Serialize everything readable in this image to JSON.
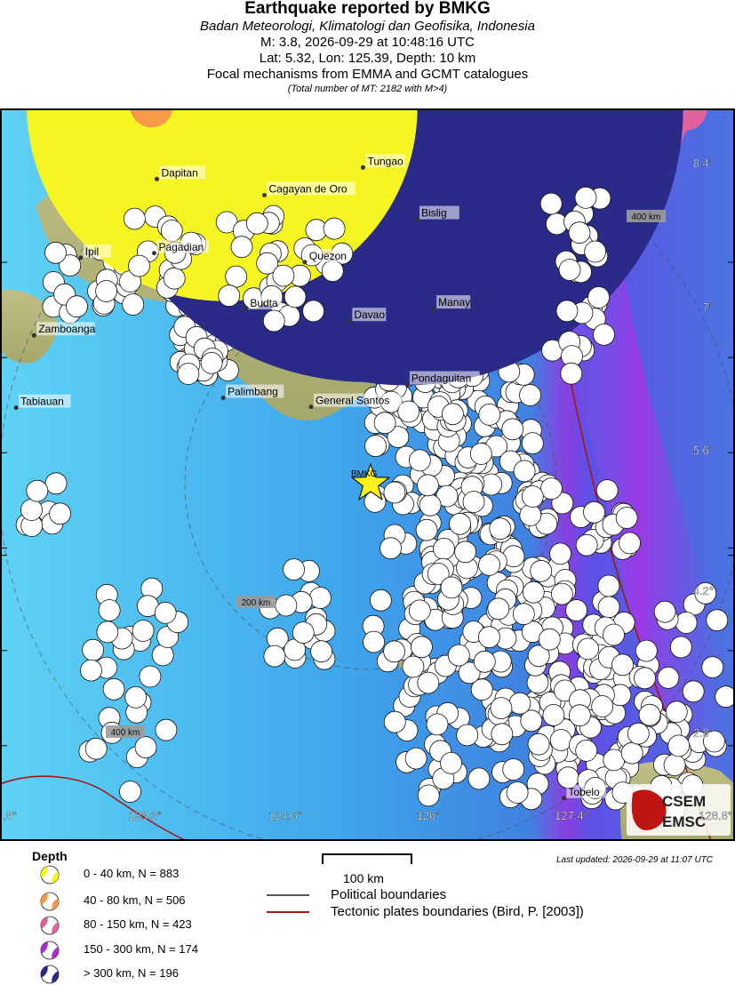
{
  "header": {
    "title": "Earthquake reported by BMKG",
    "agency": "Badan Meteorologi, Klimatologi dan Geofisika, Indonesia",
    "magnitude_line": "M: 3.8,  2026-09-29 at 10:48:16 UTC",
    "location_line": "Lat: 5.32, Lon: 125.39, Depth: 10 km",
    "focal_line": "Focal mechanisms from EMMA and GCMT catalogues",
    "total_line": "(Total number of MT: 2182 with M>4)"
  },
  "map": {
    "epicenter_label": "BMKG",
    "lat_ticks": [
      "8.4°",
      "7°",
      "5.6°",
      "4.2°",
      "2.8°"
    ],
    "lon_ticks": [
      ".8°",
      "123.2°",
      "124.6°",
      "126°",
      "127.4°",
      "128.8°"
    ],
    "distance_labels": [
      "400 km",
      "200 km",
      "400 km"
    ],
    "places": [
      {
        "name": "Dapitan",
        "lon": 123.45,
        "lat": 8.66
      },
      {
        "name": "Tungao",
        "lon": 125.75,
        "lat": 8.79
      },
      {
        "name": "Cagayan de Oro",
        "lon": 124.65,
        "lat": 8.48
      },
      {
        "name": "Bislig",
        "lon": 126.35,
        "lat": 8.21
      },
      {
        "name": "Ipil",
        "lon": 122.6,
        "lat": 7.78
      },
      {
        "name": "Pagadian",
        "lon": 123.42,
        "lat": 7.83
      },
      {
        "name": "Quezon",
        "lon": 125.1,
        "lat": 7.73
      },
      {
        "name": "Budta",
        "lon": 124.44,
        "lat": 7.2
      },
      {
        "name": "Davao",
        "lon": 125.6,
        "lat": 7.07
      },
      {
        "name": "Manay",
        "lon": 126.54,
        "lat": 7.21
      },
      {
        "name": "Zamboanga",
        "lon": 122.08,
        "lat": 6.91
      },
      {
        "name": "Palimbang",
        "lon": 124.19,
        "lat": 6.21
      },
      {
        "name": "Pondaguitan",
        "lon": 126.24,
        "lat": 6.36
      },
      {
        "name": "General Santos",
        "lon": 125.17,
        "lat": 6.11
      },
      {
        "name": "Tabiauan",
        "lon": 121.88,
        "lat": 6.1
      },
      {
        "name": "Tobelo",
        "lon": 127.99,
        "lat": 1.73
      }
    ],
    "logo": {
      "line1": "CSEM",
      "line2": "EMSC"
    }
  },
  "depth_colors": {
    "shallow": "#f6f524",
    "d40_80": "#f79a48",
    "d80_150": "#e0649b",
    "d150_300": "#a72cc8",
    "deep": "#2a2b88",
    "epicenter": "#fcf21a",
    "tectonic": "#a01818",
    "political": "#555555"
  },
  "legend": {
    "title": "Depth",
    "items": [
      {
        "label": "0 - 40 km, N = 883",
        "color": "#f6f524"
      },
      {
        "label": "40 - 80 km, N = 506",
        "color": "#f79a48"
      },
      {
        "label": "80 - 150 km, N = 423",
        "color": "#e0649b"
      },
      {
        "label": "150 - 300 km, N = 174",
        "color": "#a72cc8"
      },
      {
        "label": "> 300 km, N = 196",
        "color": "#2a2b88"
      }
    ],
    "scale_label": "100 km",
    "political_label": "Political boundaries",
    "tectonic_label": "Tectonic plates boundaries (Bird, P. [2003])",
    "last_updated": "Last updated: 2026-09-29 at 11:07 UTC"
  }
}
